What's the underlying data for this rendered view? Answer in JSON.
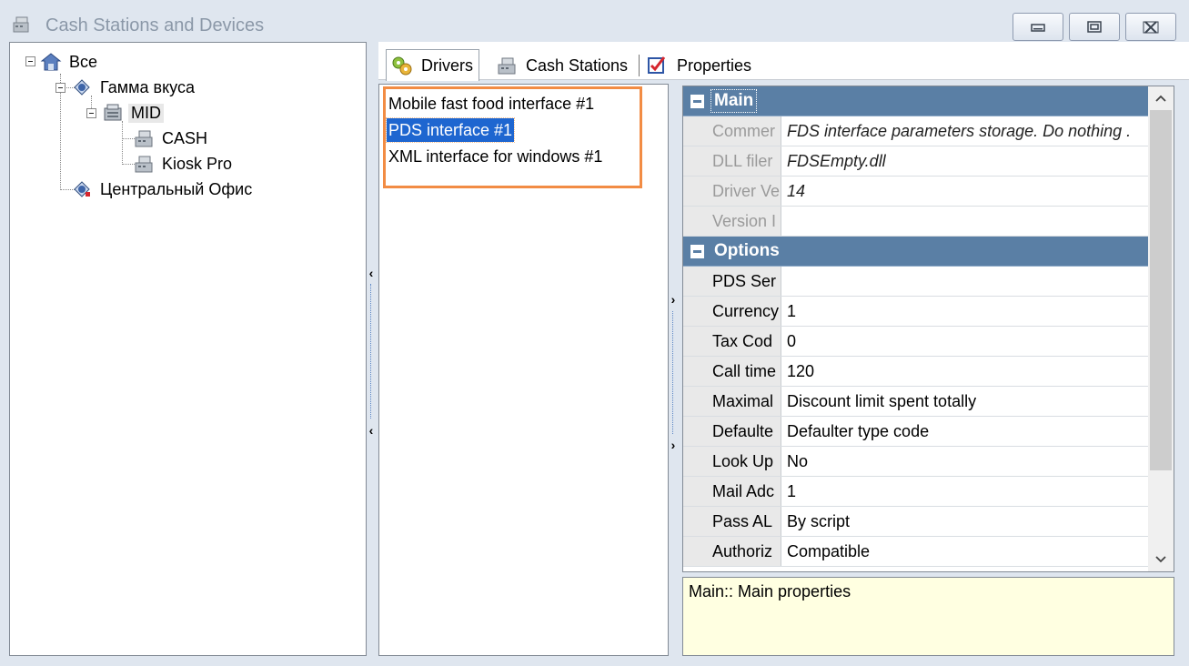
{
  "window": {
    "title": "Cash Stations and Devices"
  },
  "tree": {
    "root": "Все",
    "group1": "Гамма вкуса",
    "mid": "MID",
    "cash": "CASH",
    "kiosk": "Kiosk Pro",
    "group2": "Центральный Офис"
  },
  "tabs": {
    "drivers": "Drivers",
    "cash_stations": "Cash Stations",
    "properties": "Properties"
  },
  "drivers": {
    "items": [
      "Mobile fast food interface #1",
      "PDS interface #1",
      "XML interface for windows #1"
    ]
  },
  "grid": {
    "main_label": "Main",
    "options_label": "Options",
    "main_rows": [
      {
        "name": "Commer",
        "value": "FDS interface parameters storage. Do nothing ."
      },
      {
        "name": "DLL filer",
        "value": "FDSEmpty.dll"
      },
      {
        "name": "Driver Ve",
        "value": "14"
      },
      {
        "name": "Version I",
        "value": ""
      }
    ],
    "option_rows": [
      {
        "name": "PDS Ser",
        "value": ""
      },
      {
        "name": "Currency",
        "value": "1"
      },
      {
        "name": "Tax Cod",
        "value": "0"
      },
      {
        "name": "Call time",
        "value": "120"
      },
      {
        "name": "Maximal",
        "value": "Discount limit spent totally"
      },
      {
        "name": "Defaulte",
        "value": "Defaulter type code"
      },
      {
        "name": "Look Up",
        "value": "No"
      },
      {
        "name": "Mail Adc",
        "value": "1"
      },
      {
        "name": "Pass AL",
        "value": "By script"
      },
      {
        "name": "Authoriz",
        "value": "Compatible"
      }
    ]
  },
  "description": "Main:: Main properties",
  "icons": {
    "title": "cash-register-icon",
    "root": "house-icon",
    "group": "restaurant-icon",
    "mid": "server-icon",
    "station": "cash-register-icon",
    "drivers_tab": "gears-icon",
    "cash_tab": "cash-register-icon",
    "properties_tab": "checkbox-icon"
  },
  "colors": {
    "category_header": "#5a7fa5",
    "selection": "#1e66d0",
    "highlight_box": "#f28c44",
    "description_bg": "#ffffe1"
  }
}
